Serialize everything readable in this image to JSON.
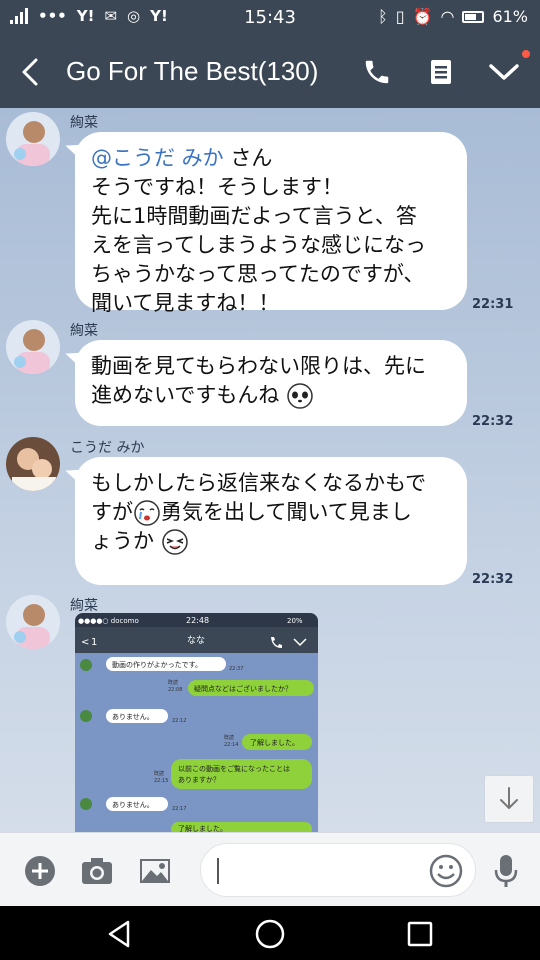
{
  "status_bar": {
    "time": "15:43",
    "battery": "61%",
    "left_icons": [
      "signal-icon",
      "dots-icon",
      "yahoo-icon",
      "mail-icon",
      "instagram-icon",
      "yahoo-icon"
    ],
    "right_icons": [
      "bluetooth-icon",
      "vibrate-icon",
      "alarm-icon",
      "wifi-icon",
      "battery-icon"
    ]
  },
  "header": {
    "title": "Go For The Best(130)",
    "icons": [
      "back-icon",
      "phone-icon",
      "notes-icon",
      "chevron-down-icon"
    ],
    "notification_dot_color": "#ff5a45"
  },
  "messages": [
    {
      "sender": "絢菜",
      "mention": "@こうだ みか",
      "mention_suffix": " さん",
      "lines": [
        "そうですね！そうします！",
        "先に1時間動画だよって言うと、答",
        "えを言ってしまうような感じになっ",
        "ちゃうかなって思ってたのですが、",
        "聞いて見ますね！！"
      ],
      "time": "22:31"
    },
    {
      "sender": "絢菜",
      "lines": [
        "動画を見てもらわない限りは、先に",
        "進めないですもんね"
      ],
      "emoji": "panda-face-icon",
      "time": "22:32"
    },
    {
      "sender": "こうだ みか",
      "lines": [
        "もしかしたら返信来なくなるかもで",
        "すが",
        "勇気を出して聞いて見まし",
        "ょうか"
      ],
      "emojis": [
        "crying-face-icon",
        "laughing-face-icon"
      ],
      "time": "22:32"
    },
    {
      "sender": "絢菜",
      "type": "image",
      "image": {
        "carrier": "●●●●○ docomo",
        "time": "22:48",
        "battery": "20%",
        "back_count": "1",
        "title": "なな",
        "bubbles": [
          {
            "side": "left",
            "text": "動画の作りがよかったです。",
            "time": "22:37"
          },
          {
            "side": "right",
            "read": "既読",
            "time": "22:08",
            "text": "疑問点などはございましたか？"
          },
          {
            "side": "left",
            "text": "ありません。",
            "time": "22:12"
          },
          {
            "side": "right",
            "read": "既読",
            "time": "22:14",
            "text": "了解しました。"
          },
          {
            "side": "right",
            "read": "既読",
            "time": "22:15",
            "text": "以前この動画をご覧になったことはありますか？"
          },
          {
            "side": "left",
            "text": "ありません。",
            "time": "22:17"
          },
          {
            "side": "right",
            "text": "了解しました。"
          }
        ]
      }
    }
  ],
  "input_bar": {
    "placeholder": "",
    "icons": [
      "plus-icon",
      "camera-icon",
      "image-icon",
      "smiley-icon",
      "microphone-icon"
    ]
  },
  "nav_bar": {
    "icons": [
      "back-triangle-icon",
      "home-circle-icon",
      "recents-square-icon"
    ]
  },
  "colors": {
    "header_bg": "#3b4754",
    "bubble_left": "#ffffff",
    "mention": "#3b73c4",
    "line_green": "#8ed13b"
  }
}
